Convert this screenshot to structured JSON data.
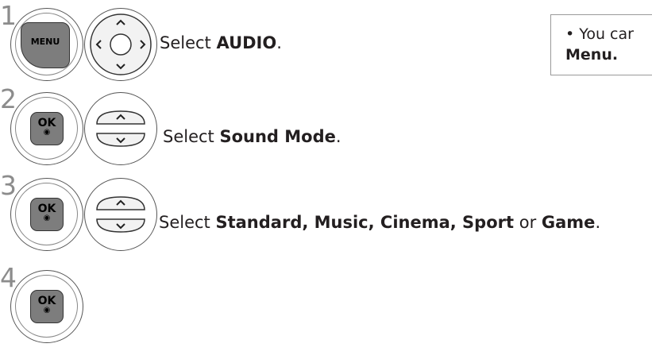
{
  "steps": [
    {
      "number": "1",
      "key": "MENU",
      "text_prefix": "Select ",
      "text_bold": "AUDIO",
      "text_suffix": "."
    },
    {
      "number": "2",
      "key": "OK",
      "text_prefix": "Select ",
      "text_bold": "Sound Mode",
      "text_suffix": "."
    },
    {
      "number": "3",
      "key": "OK",
      "items": [
        {
          "text": "Select ",
          "bold": false
        },
        {
          "text": "Standard, Music, Cinema, Sport",
          "bold": true
        },
        {
          "text": " or ",
          "bold": false
        },
        {
          "text": "Game",
          "bold": true
        },
        {
          "text": ".",
          "bold": false
        }
      ]
    },
    {
      "number": "4",
      "key": "OK"
    }
  ],
  "note": {
    "line1": "• You car",
    "line2": "Menu."
  },
  "icons": {
    "dpad": "navigation-dpad-icon",
    "updown": "up-down-arrows-icon",
    "ok_dot": "◉"
  },
  "colors": {
    "key_fill": "#7d7d7d",
    "step_number": "#8c8c8c",
    "text": "#231f20"
  }
}
